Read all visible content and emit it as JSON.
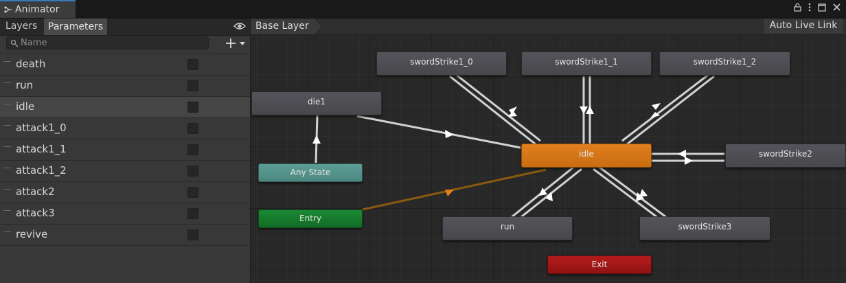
{
  "window": {
    "tab_title": "Animator",
    "icons": [
      "lock-icon",
      "kebab-menu-icon",
      "maximize-icon",
      "close-icon"
    ]
  },
  "left_panel": {
    "tabs": [
      {
        "label": "Layers",
        "active": false
      },
      {
        "label": "Parameters",
        "active": true
      }
    ],
    "search": {
      "placeholder": "Name",
      "value": ""
    },
    "parameters": [
      {
        "name": "death",
        "value": false,
        "selected": false
      },
      {
        "name": "run",
        "value": false,
        "selected": false
      },
      {
        "name": "idle",
        "value": false,
        "selected": true
      },
      {
        "name": "attack1_0",
        "value": false,
        "selected": false
      },
      {
        "name": "attack1_1",
        "value": false,
        "selected": false
      },
      {
        "name": "attack1_2",
        "value": false,
        "selected": false
      },
      {
        "name": "attack2",
        "value": false,
        "selected": false
      },
      {
        "name": "attack3",
        "value": false,
        "selected": false
      },
      {
        "name": "revive",
        "value": false,
        "selected": false
      }
    ]
  },
  "graph": {
    "breadcrumb": "Base Layer",
    "auto_live_link_label": "Auto Live Link",
    "states": {
      "swordStrike1_0": "swordStrike1_0",
      "swordStrike1_1": "swordStrike1_1",
      "swordStrike1_2": "swordStrike1_2",
      "die1": "die1",
      "any_state": "Any State",
      "idle": "idle",
      "swordStrike2": "swordStrike2",
      "entry": "Entry",
      "run": "run",
      "swordStrike3": "swordStrike3",
      "exit": "Exit"
    },
    "colors": {
      "default_state": "#e0801f",
      "any_state": "#5b9e96",
      "entry": "#1b8a34",
      "exit": "#b51b1b",
      "normal_state": "#4d4d52",
      "transition": "#d2d2d2",
      "default_transition": "#8a5a10"
    }
  }
}
